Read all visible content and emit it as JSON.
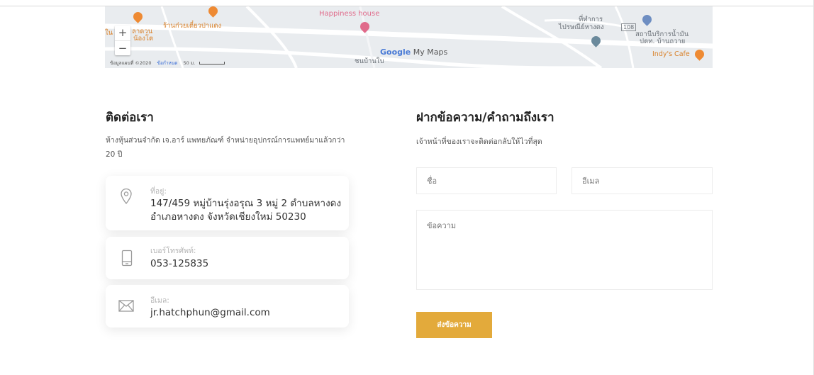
{
  "map": {
    "places": {
      "restaurant": "ร้านก๋วยเตี๋ยวป่าแดง",
      "happiness": "Happiness house",
      "left_cut1": "ใน",
      "left_cut2": "ลาดวน",
      "left_cut3": "น้องโต",
      "post_office_1": "ที่ทำการ",
      "post_office_2": "ไปรษณีย์หางดง",
      "gas_station_1": "สถานีบริการน้ำมัน",
      "gas_station_2": "ปตท. บ้านถวาย",
      "indys": "Indy's Cafe",
      "village": "ชนบ้านใบ"
    },
    "zoom_in": "+",
    "zoom_out": "−",
    "brand_google": "Google",
    "brand_suffix": "My Maps",
    "footer_data": "ข้อมูลแผนที่ ©2020",
    "footer_terms": "ข้อกำหนด",
    "footer_scale": "50 ม."
  },
  "contact": {
    "heading": "ติดต่อเรา",
    "intro": "ห้างหุ้นส่วนจำกัด เจ.อาร์ แพทยภัณฑ์ จำหน่ายอุปกรณ์การแพทย์มาแล้วกว่า 20 ปี",
    "address_label": "ที่อยู่:",
    "address_line1": "147/459 หมู่บ้านรุ่งอรุณ 3 หมู่ 2 ตำบลหางดง",
    "address_line2": "อำเภอหางดง จังหวัดเชียงใหม่ 50230",
    "phone_label": "เบอร์โทรศัพท์:",
    "phone_value": "053-125835",
    "email_label": "อีเมล:",
    "email_value": "jr.hatchphun@gmail.com"
  },
  "form": {
    "heading": "ฝากข้อความ/คำถามถึงเรา",
    "subtitle": "เจ้าหน้าที่ของเราจะติดต่อกลับให้ไวที่สุด",
    "name_placeholder": "ชื่อ",
    "email_placeholder": "อีเมล",
    "message_placeholder": "ข้อความ",
    "submit_label": "ส่งข้อความ"
  },
  "colors": {
    "accent": "#e3aa3b",
    "map_bg": "#e9ecef"
  }
}
